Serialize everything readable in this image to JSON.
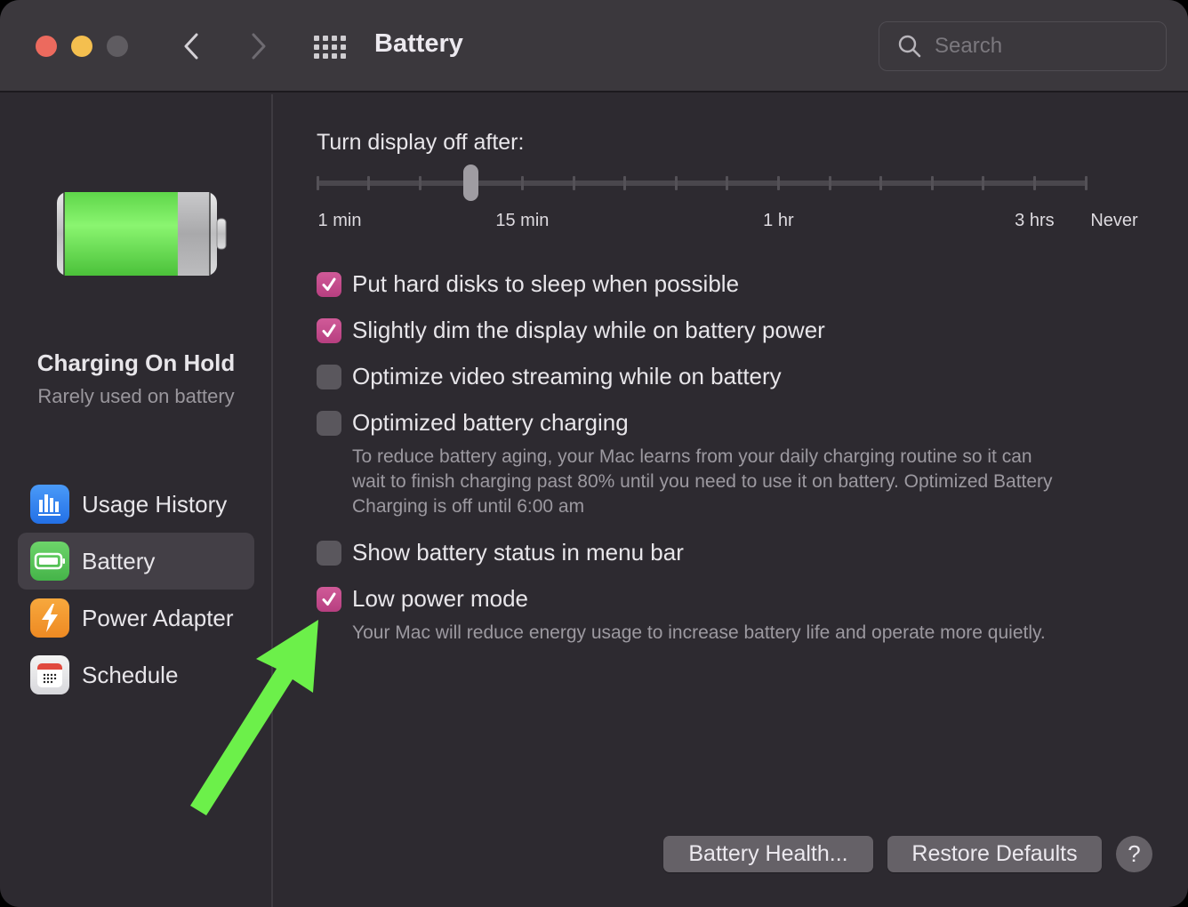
{
  "window": {
    "title": "Battery",
    "search_placeholder": "Search",
    "search_value": ""
  },
  "sidebar": {
    "battery_level_percent": 78,
    "status_title": "Charging On Hold",
    "status_subtitle": "Rarely used on battery",
    "items": [
      {
        "label": "Usage History",
        "icon": "bar-chart-icon",
        "selected": false
      },
      {
        "label": "Battery",
        "icon": "battery-icon",
        "selected": true
      },
      {
        "label": "Power Adapter",
        "icon": "lightning-bolt-icon",
        "selected": false
      },
      {
        "label": "Schedule",
        "icon": "calendar-icon",
        "selected": false
      }
    ]
  },
  "display_slider": {
    "label": "Turn display off after:",
    "tick_count": 16,
    "selected_index": 3,
    "selected_value": "10 min",
    "tick_labels": [
      {
        "text": "1 min",
        "index": 0
      },
      {
        "text": "15 min",
        "index": 4
      },
      {
        "text": "1 hr",
        "index": 9
      },
      {
        "text": "3 hrs",
        "index": 14
      },
      {
        "text": "Never",
        "index": 15
      }
    ]
  },
  "options": [
    {
      "label": "Put hard disks to sleep when possible",
      "checked": true
    },
    {
      "label": "Slightly dim the display while on battery power",
      "checked": true
    },
    {
      "label": "Optimize video streaming while on battery",
      "checked": false
    },
    {
      "label": "Optimized battery charging",
      "checked": false,
      "description": [
        "To reduce battery aging, your Mac learns from your daily charging routine so it can",
        "wait to finish charging past 80% until you need to use it on battery. Optimized Battery",
        "Charging is off until 6:00 am"
      ]
    },
    {
      "label": "Show battery status in menu bar",
      "checked": false
    },
    {
      "label": "Low power mode",
      "checked": true,
      "description": [
        "Your Mac will reduce energy usage to increase battery life and operate more quietly."
      ]
    }
  ],
  "buttons": {
    "battery_health": "Battery Health...",
    "restore_defaults": "Restore Defaults",
    "help": "?"
  },
  "colors": {
    "accent": "#c84b8c",
    "annotation_arrow": "#6cf04a",
    "battery_fill": "#78e85a"
  },
  "annotation": {
    "type": "arrow",
    "points_to": "Low power mode checkbox"
  }
}
